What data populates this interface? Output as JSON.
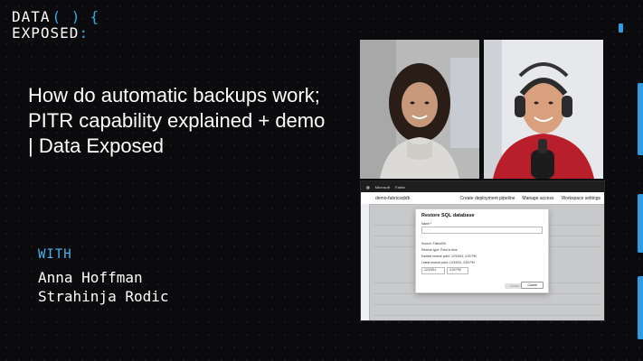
{
  "logo": {
    "line1": "DATA",
    "brackets": "( )",
    "brace": "{",
    "line2": "EXPOSED",
    "line2_end": ":"
  },
  "title": "How do automatic backups work; PITR capability explained + demo | Data Exposed",
  "with_label": "WITH",
  "presenters": [
    "Anna Hoffman",
    "Strahinja Rodic"
  ],
  "colors": {
    "accent": "#2f9be3",
    "background": "#0b0b0d"
  },
  "share": {
    "topbar": [
      "Microsoft",
      "Fabric"
    ],
    "workspace": "demo-fabricsqldb",
    "toolbar": [
      "Create deployment pipeline",
      "Manage access",
      "Workspace settings"
    ],
    "dialog": {
      "title": "Restore SQL database",
      "name_label": "Name *",
      "source_label": "Source: FabricDB",
      "type_label": "Restore type: Point in time",
      "earliest_label": "Earliest restore point: 12/19/24, 4:00 PM",
      "latest_label": "Latest restore point: 12/19/24, 3:50 PM",
      "date_value": "12/19/24",
      "time_value": "3:00 PM",
      "create_label": "Create",
      "cancel_label": "Cancel"
    }
  }
}
